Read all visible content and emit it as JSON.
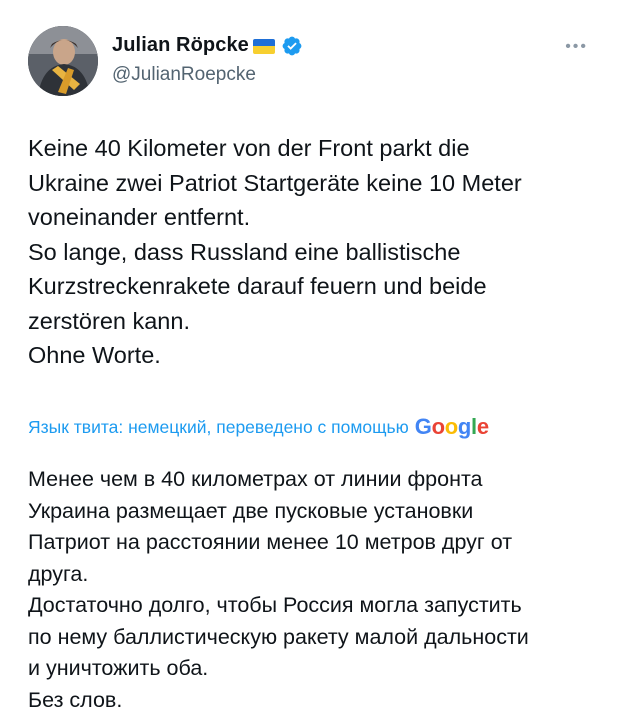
{
  "author": {
    "display_name": "Julian Röpcke",
    "handle": "@JulianRoepcke",
    "flag": "ukraine-flag",
    "verified": true
  },
  "tweet_text": "Keine 40 Kilometer von der Front parkt die\nUkraine zwei Patriot Startgeräte keine 10 Meter\nvoneinander entfernt.\nSo lange, dass Russland eine ballistische\nKurzstreckenrakete darauf feuern und beide\nzerstören kann.\nOhne Worte.",
  "translation": {
    "label": "Язык твита: немецкий, переведено с помощью",
    "provider": "Google",
    "text": "Менее чем в 40 километрах от линии фронта\nУкраина размещает две пусковые установки\nПатриот на расстоянии менее 10 метров друг от\nдруга.\nДостаточно долго, чтобы Россия могла запустить\nпо нему баллистическую ракету малой дальности\nи уничтожить оба.\nБез слов."
  },
  "colors": {
    "accent": "#1d9bf0",
    "text": "#0f1419",
    "secondary": "#536471"
  }
}
